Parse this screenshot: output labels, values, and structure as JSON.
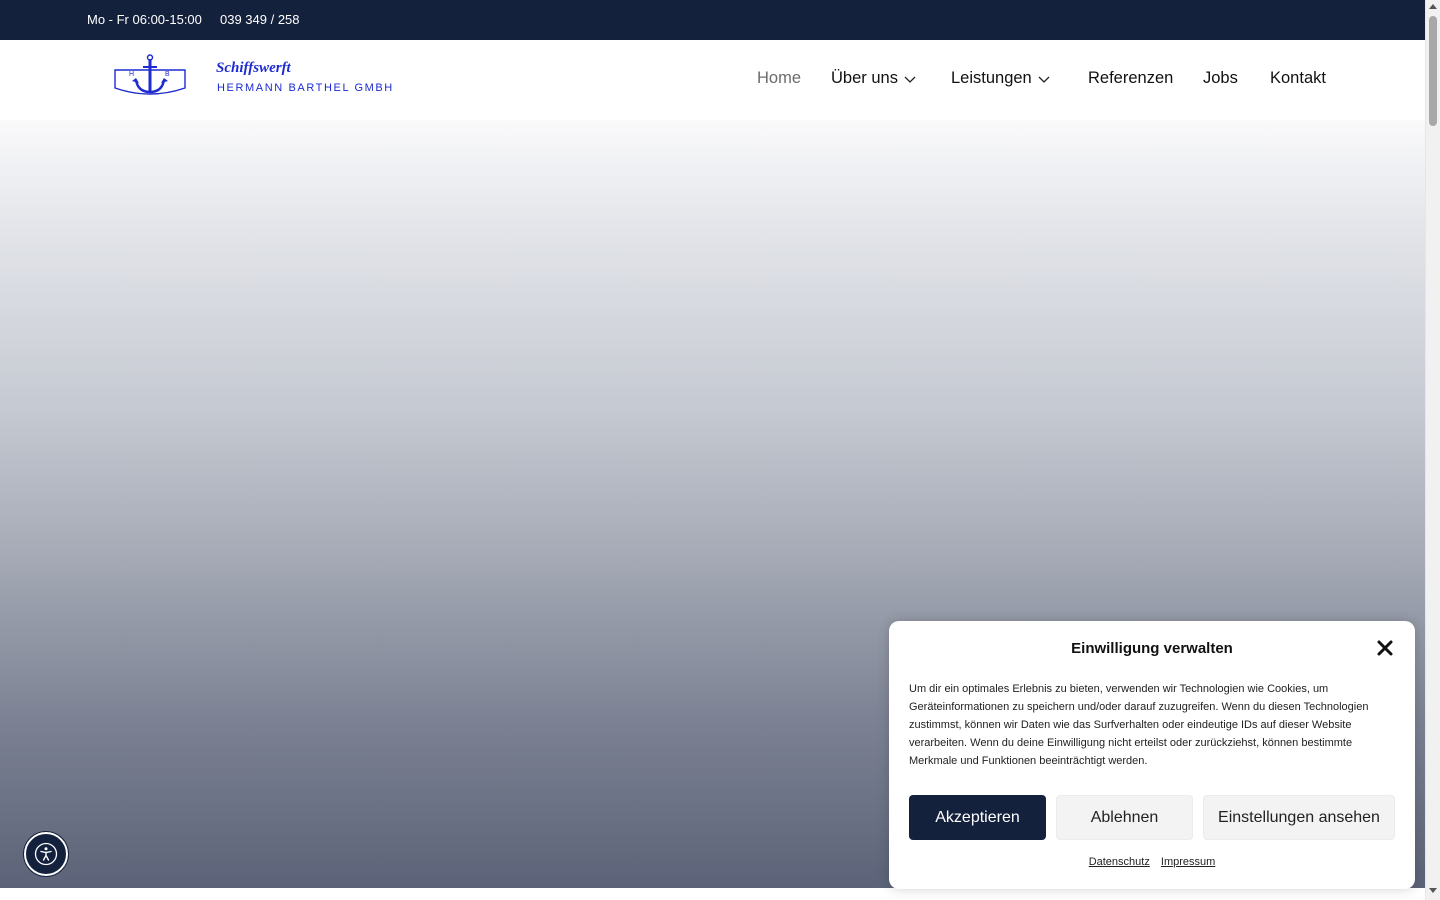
{
  "topbar": {
    "hours": "Mo - Fr 06:00-15:00",
    "phone": "039 349 / 258"
  },
  "logo": {
    "monogram_left": "H",
    "monogram_right": "B",
    "brand_top": "Schiffswerft",
    "brand_bottom": "HERMANN BARTHEL GMBH"
  },
  "nav": {
    "items": [
      {
        "label": "Home",
        "active": true
      },
      {
        "label": "Über uns",
        "dropdown": true
      },
      {
        "label": "Leistungen",
        "dropdown": true
      },
      {
        "label": "Referenzen"
      },
      {
        "label": "Jobs"
      },
      {
        "label": "Kontakt"
      }
    ]
  },
  "consent": {
    "title": "Einwilligung verwalten",
    "text": "Um dir ein optimales Erlebnis zu bieten, verwenden wir Technologien wie Cookies, um Geräteinformationen zu speichern und/oder darauf zuzugreifen. Wenn du diesen Technologien zustimmst, können wir Daten wie das Surfverhalten oder eindeutige IDs auf dieser Website verarbeiten. Wenn du deine Einwilligung nicht erteilst oder zurückziehst, können bestimmte Merkmale und Funktionen beeinträchtigt werden.",
    "accept_label": "Akzeptieren",
    "deny_label": "Ablehnen",
    "view_label": "Einstellungen ansehen",
    "link_privacy": "Datenschutz",
    "link_imprint": "Impressum"
  },
  "colors": {
    "navy": "#14213d",
    "logo_blue": "#1d2bd0"
  },
  "icons": {
    "accessibility": "accessibility-icon",
    "close": "close-icon",
    "chevron": "chevron-down-icon",
    "anchor": "anchor-icon"
  }
}
